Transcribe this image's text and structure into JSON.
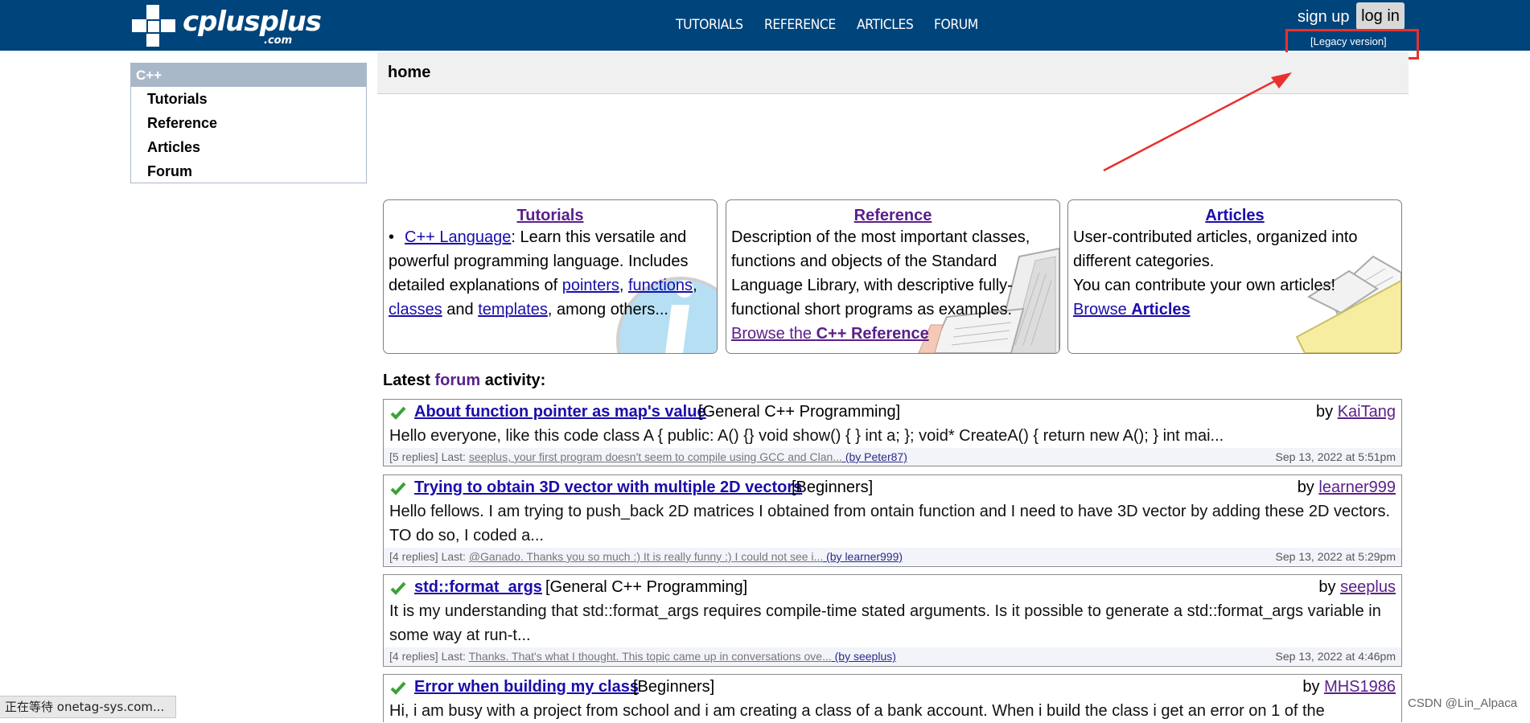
{
  "header": {
    "logo_text": "cplusplus",
    "logo_sub": ".com",
    "nav": [
      "TUTORIALS",
      "REFERENCE",
      "ARTICLES",
      "FORUM"
    ],
    "signup": "sign up",
    "login": "log in",
    "legacy": "[Legacy version]"
  },
  "sidebar": {
    "heading": "C++",
    "items": [
      "Tutorials",
      "Reference",
      "Articles",
      "Forum"
    ]
  },
  "crumb": "home",
  "features": {
    "tutorials": {
      "title": "Tutorials",
      "bullet_link": "C++ Language",
      "text_1": ": Learn this versatile and powerful programming language. Includes detailed explanations of ",
      "link_pointers": "pointers",
      "comma_1": ", ",
      "link_functions": "functions",
      "comma_2": ", ",
      "link_classes": "classes",
      "text_and": " and ",
      "link_templates": "templates",
      "text_end": ", among others..."
    },
    "reference": {
      "title": "Reference",
      "text": "Description of the most important classes, functions and objects of the Standard Language Library, with descriptive fully-functional short programs as examples.",
      "browse_prefix": "Browse the ",
      "browse_bold": "C++ Reference"
    },
    "articles": {
      "title": "Articles",
      "text_1": "User-contributed articles, organized into different categories.",
      "text_2": "You can contribute your own articles!",
      "browse_prefix": "Browse ",
      "browse_bold": "Articles"
    }
  },
  "latest": {
    "prefix": "Latest ",
    "link": "forum",
    "suffix": " activity:"
  },
  "posts": [
    {
      "title": "About function pointer as map's value",
      "category": "[General C++ Programming]",
      "by_label": "by ",
      "author": "KaiTang",
      "body": "Hello everyone, like this code class A { public: A() {} void show() { } int a; }; void* CreateA() { return new A(); } int mai...",
      "replies": "[5 replies] Last: ",
      "last": "seeplus, your first program doesn't seem to compile using GCC and Clan...",
      "last_by": " (by Peter87)",
      "date": "Sep 13, 2022 at 5:51pm"
    },
    {
      "title": "Trying to obtain 3D vector with multiple 2D vectors",
      "category": "[Beginners]",
      "by_label": "by ",
      "author": "learner999",
      "body": "Hello fellows. I am trying to push_back 2D matrices I obtained from ontain function and I need to have 3D vector by adding these 2D vectors. TO do so, I coded a...",
      "replies": "[4 replies] Last: ",
      "last": "@Ganado. Thanks you so much :) It is really funny :) I could not see i...",
      "last_by": " (by learner999)",
      "date": "Sep 13, 2022 at 5:29pm"
    },
    {
      "title": "std::format_args",
      "category": "[General C++ Programming]",
      "by_label": "by ",
      "author": "seeplus",
      "body": "It is my understanding that std::format_args requires compile-time stated arguments. Is it possible to generate a std::format_args variable in some way at run-t...",
      "replies": "[4 replies] Last: ",
      "last": "Thanks. That's what I thought. This topic came up in conversations ove...",
      "last_by": " (by seeplus)",
      "date": "Sep 13, 2022 at 4:46pm"
    },
    {
      "title": "Error when building my class",
      "category": "[Beginners]",
      "by_label": "by ",
      "author": "MHS1986",
      "body": "Hi, i am busy with a project from school and i am creating a class of a bank account. When i build the class i get an error on 1 of the"
    }
  ],
  "status": "正在等待 onetag-sys.com...",
  "watermark": "CSDN @Lin_Alpaca",
  "colors": {
    "header_bg": "#00447c",
    "highlight": "#e8302e",
    "check": "#3aa335",
    "visited_link": "#5a1f8a",
    "link": "#1a0dab"
  }
}
